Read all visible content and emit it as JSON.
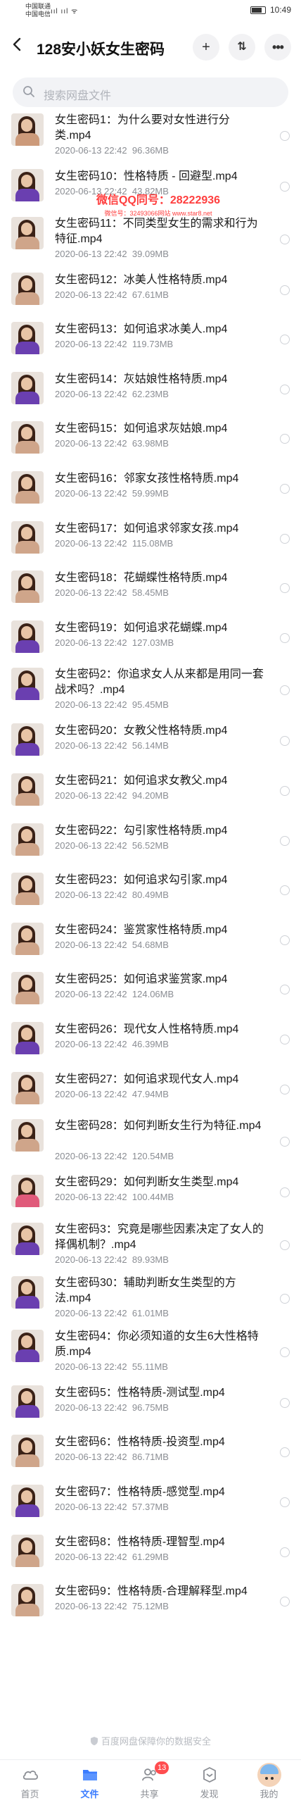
{
  "status_bar": {
    "carrier1": "中国联通",
    "carrier2": "中国电信",
    "signal_text": "ııl ııl ᯤ",
    "time": "10:49"
  },
  "nav": {
    "back_icon": "‹",
    "title": "128安小妖女生密码",
    "add_icon": "+",
    "sort_icon": "⇅",
    "more_icon": "•••"
  },
  "search": {
    "placeholder": "搜索网盘文件"
  },
  "watermark": {
    "line1": "微信QQ同号：28222936",
    "line2": "微信号：32493066网站 www.star8.net"
  },
  "files": [
    {
      "name": "女生密码1：为什么要对女性进行分类.mp4",
      "date": "2020-06-13  22:42",
      "size": "96.36MB",
      "body": "#cc9a7a"
    },
    {
      "name": "女生密码10：性格特质 - 回避型.mp4",
      "date": "2020-06-13  22:42",
      "size": "43.82MB",
      "body": "#6a3fb0"
    },
    {
      "name": "女生密码11：不同类型女生的需求和行为特征.mp4",
      "date": "2020-06-13  22:42",
      "size": "39.09MB",
      "body": "#cfa58a"
    },
    {
      "name": "女生密码12：冰美人性格特质.mp4",
      "date": "2020-06-13  22:42",
      "size": "67.61MB",
      "body": "#cfa58a"
    },
    {
      "name": "女生密码13：如何追求冰美人.mp4",
      "date": "2020-06-13  22:42",
      "size": "119.73MB",
      "body": "#6a3fb0"
    },
    {
      "name": "女生密码14：灰姑娘性格特质.mp4",
      "date": "2020-06-13  22:42",
      "size": "62.23MB",
      "body": "#6a3fb0"
    },
    {
      "name": "女生密码15：如何追求灰姑娘.mp4",
      "date": "2020-06-13  22:42",
      "size": "63.98MB",
      "body": "#cfa58a"
    },
    {
      "name": "女生密码16：邻家女孩性格特质.mp4",
      "date": "2020-06-13  22:42",
      "size": "59.99MB",
      "body": "#cfa58a"
    },
    {
      "name": "女生密码17：如何追求邻家女孩.mp4",
      "date": "2020-06-13  22:42",
      "size": "115.08MB",
      "body": "#cfa58a"
    },
    {
      "name": "女生密码18：花蝴蝶性格特质.mp4",
      "date": "2020-06-13  22:42",
      "size": "58.45MB",
      "body": "#cfa58a"
    },
    {
      "name": "女生密码19：如何追求花蝴蝶.mp4",
      "date": "2020-06-13  22:42",
      "size": "127.03MB",
      "body": "#6a3fb0"
    },
    {
      "name": "女生密码2：你追求女人从来都是用同一套战术吗？.mp4",
      "date": "2020-06-13  22:42",
      "size": "95.45MB",
      "body": "#6a3fb0"
    },
    {
      "name": "女生密码20：女教父性格特质.mp4",
      "date": "2020-06-13  22:42",
      "size": "56.14MB",
      "body": "#6a3fb0"
    },
    {
      "name": "女生密码21：如何追求女教父.mp4",
      "date": "2020-06-13  22:42",
      "size": "94.20MB",
      "body": "#cfa58a"
    },
    {
      "name": "女生密码22：勾引家性格特质.mp4",
      "date": "2020-06-13  22:42",
      "size": "56.52MB",
      "body": "#cfa58a"
    },
    {
      "name": "女生密码23：如何追求勾引家.mp4",
      "date": "2020-06-13  22:42",
      "size": "80.49MB",
      "body": "#cfa58a"
    },
    {
      "name": "女生密码24：鉴赏家性格特质.mp4",
      "date": "2020-06-13  22:42",
      "size": "54.68MB",
      "body": "#cfa58a"
    },
    {
      "name": "女生密码25：如何追求鉴赏家.mp4",
      "date": "2020-06-13  22:42",
      "size": "124.06MB",
      "body": "#cfa58a"
    },
    {
      "name": "女生密码26：现代女人性格特质.mp4",
      "date": "2020-06-13  22:42",
      "size": "46.39MB",
      "body": "#6a3fb0"
    },
    {
      "name": "女生密码27：如何追求现代女人.mp4",
      "date": "2020-06-13  22:42",
      "size": "47.94MB",
      "body": "#cfa58a"
    },
    {
      "name": "女生密码28：如何判断女生行为特征.mp4",
      "date": "2020-06-13  22:42",
      "size": "120.54MB",
      "body": "#cfa58a"
    },
    {
      "name": "女生密码29：如何判断女生类型.mp4",
      "date": "2020-06-13  22:42",
      "size": "100.44MB",
      "body": "#e05a7a"
    },
    {
      "name": "女生密码3：究竟是哪些因素决定了女人的择偶机制？.mp4",
      "date": "2020-06-13  22:42",
      "size": "89.93MB",
      "body": "#6a3fb0"
    },
    {
      "name": "女生密码30：辅助判断女生类型的方法.mp4",
      "date": "2020-06-13  22:42",
      "size": "61.01MB",
      "body": "#6a3fb0"
    },
    {
      "name": "女生密码4：你必须知道的女生6大性格特质.mp4",
      "date": "2020-06-13  22:42",
      "size": "55.11MB",
      "body": "#6a3fb0"
    },
    {
      "name": "女生密码5：性格特质-测试型.mp4",
      "date": "2020-06-13  22:42",
      "size": "96.75MB",
      "body": "#6a3fb0"
    },
    {
      "name": "女生密码6：性格特质-投资型.mp4",
      "date": "2020-06-13  22:42",
      "size": "86.71MB",
      "body": "#cfa58a"
    },
    {
      "name": "女生密码7：性格特质-感觉型.mp4",
      "date": "2020-06-13  22:42",
      "size": "57.37MB",
      "body": "#6a3fb0"
    },
    {
      "name": "女生密码8：性格特质-理智型.mp4",
      "date": "2020-06-13  22:42",
      "size": "61.29MB",
      "body": "#cfa58a"
    },
    {
      "name": "女生密码9：性格特质-合理解释型.mp4",
      "date": "2020-06-13  22:42",
      "size": "75.12MB",
      "body": "#cfa58a"
    }
  ],
  "footer_note": "百度网盘保障你的数据安全",
  "tabs": [
    {
      "label": "首页",
      "icon": "cloud-icon"
    },
    {
      "label": "文件",
      "icon": "folder-icon",
      "active": true
    },
    {
      "label": "共享",
      "icon": "share-icon",
      "badge": "13"
    },
    {
      "label": "发现",
      "icon": "discover-icon"
    },
    {
      "label": "我的",
      "icon": "avatar"
    }
  ],
  "colors": {
    "accent": "#3a7cff",
    "badge": "#ff4d4f",
    "watermark": "#ff2a2a"
  }
}
